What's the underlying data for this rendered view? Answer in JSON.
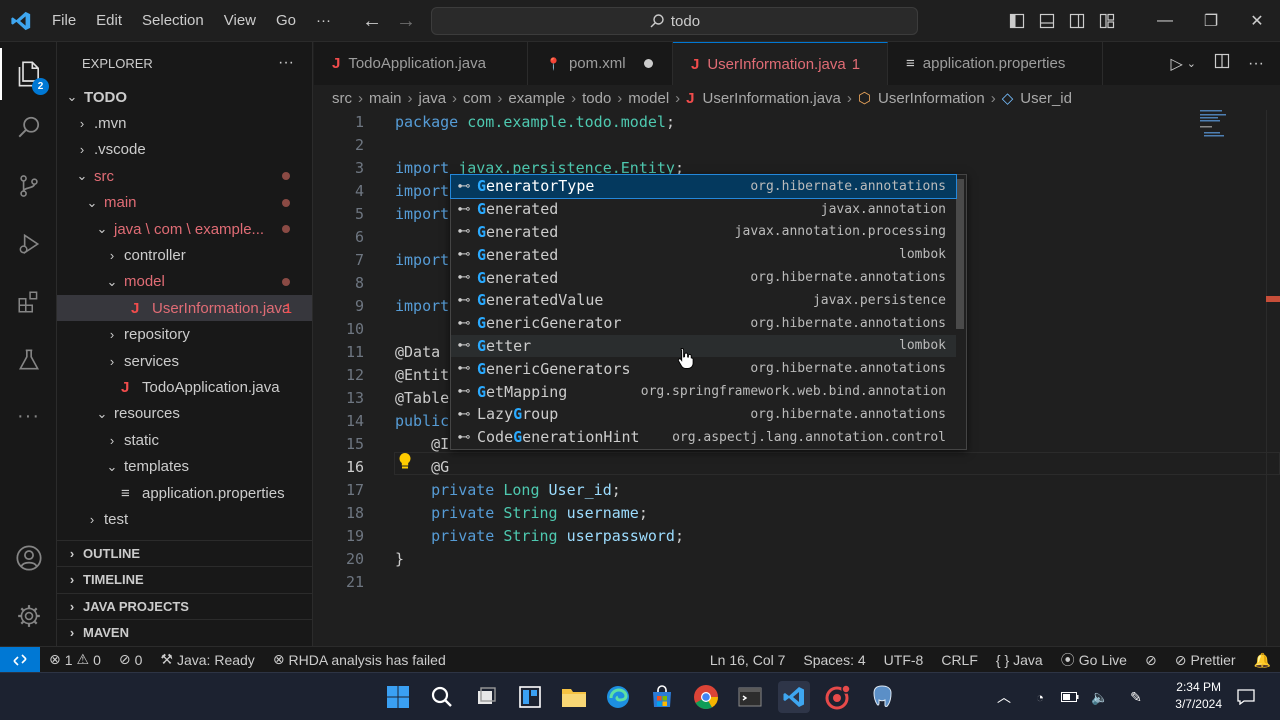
{
  "titlebar": {
    "menu": [
      "File",
      "Edit",
      "Selection",
      "View",
      "Go",
      "···"
    ],
    "search": "todo"
  },
  "activity": {
    "explorer_badge": "2"
  },
  "sidebar": {
    "title": "EXPLORER",
    "more": "···",
    "tree": [
      {
        "label": "TODO",
        "chevron": "⌄",
        "indent": 0,
        "bold": true
      },
      {
        "label": ".mvn",
        "chevron": "›",
        "indent": 1
      },
      {
        "label": ".vscode",
        "chevron": "›",
        "indent": 1
      },
      {
        "label": "src",
        "chevron": "⌄",
        "indent": 1,
        "color": "#e06c75",
        "dot": true
      },
      {
        "label": "main",
        "chevron": "⌄",
        "indent": 2,
        "color": "#e06c75",
        "dot": true
      },
      {
        "label": "java \\ com \\ example...",
        "chevron": "⌄",
        "indent": 3,
        "color": "#e06c75",
        "dot": true
      },
      {
        "label": "controller",
        "chevron": "›",
        "indent": 4
      },
      {
        "label": "model",
        "chevron": "⌄",
        "indent": 4,
        "color": "#e06c75",
        "dot": true
      },
      {
        "label": "UserInformation.java",
        "chevron": "",
        "indent": 5,
        "color": "#e06c75",
        "icon": "J",
        "err": "1",
        "selected": true
      },
      {
        "label": "repository",
        "chevron": "›",
        "indent": 4
      },
      {
        "label": "services",
        "chevron": "›",
        "indent": 4
      },
      {
        "label": "TodoApplication.java",
        "chevron": "",
        "indent": 4,
        "icon": "J"
      },
      {
        "label": "resources",
        "chevron": "⌄",
        "indent": 3
      },
      {
        "label": "static",
        "chevron": "›",
        "indent": 4
      },
      {
        "label": "templates",
        "chevron": "⌄",
        "indent": 4
      },
      {
        "label": "application.properties",
        "chevron": "",
        "indent": 4,
        "icon": "≡"
      },
      {
        "label": "test",
        "chevron": "›",
        "indent": 2
      }
    ],
    "sections": [
      "OUTLINE",
      "TIMELINE",
      "JAVA PROJECTS",
      "MAVEN"
    ]
  },
  "tabs": [
    {
      "label": "TodoApplication.java",
      "icon": "J",
      "icon_color": "#f14c4c"
    },
    {
      "label": "pom.xml",
      "icon": "📍",
      "modified": true
    },
    {
      "label": "UserInformation.java",
      "suffix": "1",
      "icon": "J",
      "icon_color": "#f14c4c",
      "active": true,
      "modified": true
    },
    {
      "label": "application.properties",
      "icon": "≡"
    }
  ],
  "breadcrumbs": [
    "src",
    "main",
    "java",
    "com",
    "example",
    "todo",
    "model",
    "UserInformation.java",
    "UserInformation",
    "User_id"
  ],
  "editor": {
    "current_line": 16,
    "lines": [
      [
        [
          "kw",
          "package "
        ],
        [
          "pkg",
          "com.example.todo.model"
        ],
        [
          "t",
          ";"
        ]
      ],
      [],
      [
        [
          "kw",
          "import "
        ],
        [
          "pkg",
          "javax.persistence.Entity"
        ],
        [
          "t",
          ";"
        ]
      ],
      [
        [
          "kw",
          "import"
        ]
      ],
      [
        [
          "kw",
          "import"
        ]
      ],
      [],
      [
        [
          "kw",
          "import"
        ]
      ],
      [],
      [
        [
          "kw",
          "import"
        ]
      ],
      [],
      [
        [
          "ann",
          "@Data"
        ]
      ],
      [
        [
          "ann",
          "@Entit"
        ]
      ],
      [
        [
          "ann",
          "@Table"
        ]
      ],
      [
        [
          "kw",
          "public"
        ]
      ],
      [
        [
          "t",
          "    "
        ],
        [
          "ann",
          "@I"
        ]
      ],
      [
        [
          "t",
          "    "
        ],
        [
          "ann",
          "@G"
        ]
      ],
      [
        [
          "t",
          "    "
        ],
        [
          "kw",
          "private "
        ],
        [
          "ty",
          "Long "
        ],
        [
          "var",
          "User_id"
        ],
        [
          "t",
          ";"
        ]
      ],
      [
        [
          "t",
          "    "
        ],
        [
          "kw",
          "private "
        ],
        [
          "ty",
          "String "
        ],
        [
          "var",
          "username"
        ],
        [
          "t",
          ";"
        ]
      ],
      [
        [
          "t",
          "    "
        ],
        [
          "kw",
          "private "
        ],
        [
          "ty",
          "String "
        ],
        [
          "var",
          "userpassword"
        ],
        [
          "t",
          ";"
        ]
      ],
      [
        [
          "t",
          "}"
        ]
      ],
      []
    ]
  },
  "suggestions": [
    {
      "match": "G",
      "rest": "eneratorType",
      "detail": "org.hibernate.annotations",
      "selected": true
    },
    {
      "match": "G",
      "rest": "enerated",
      "detail": "javax.annotation"
    },
    {
      "match": "G",
      "rest": "enerated",
      "detail": "javax.annotation.processing"
    },
    {
      "match": "G",
      "rest": "enerated",
      "detail": "lombok"
    },
    {
      "match": "G",
      "rest": "enerated",
      "detail": "org.hibernate.annotations"
    },
    {
      "match": "G",
      "rest": "eneratedValue",
      "detail": "javax.persistence"
    },
    {
      "match": "G",
      "rest": "enericGenerator",
      "detail": "org.hibernate.annotations"
    },
    {
      "match": "G",
      "rest": "etter",
      "detail": "lombok",
      "hover": true
    },
    {
      "match": "G",
      "rest": "enericGenerators",
      "detail": "org.hibernate.annotations"
    },
    {
      "match": "G",
      "rest": "etMapping",
      "detail": "org.springframework.web.bind.annotation"
    },
    {
      "pre": "Lazy",
      "match": "G",
      "rest": "roup",
      "detail": "org.hibernate.annotations"
    },
    {
      "pre": "Code",
      "match": "G",
      "rest": "enerationHint",
      "detail": "org.aspectj.lang.annotation.control"
    }
  ],
  "statusbar": {
    "errors": "1",
    "warnings": "0",
    "ports": "0",
    "java": "Java: Ready",
    "rhda": "RHDA analysis has failed",
    "position": "Ln 16, Col 7",
    "spaces": "Spaces: 4",
    "encoding": "UTF-8",
    "eol": "CRLF",
    "language": "Java",
    "golive": "Go Live",
    "prettier": "Prettier"
  },
  "taskbar": {
    "time": "2:34 PM",
    "date": "3/7/2024"
  }
}
